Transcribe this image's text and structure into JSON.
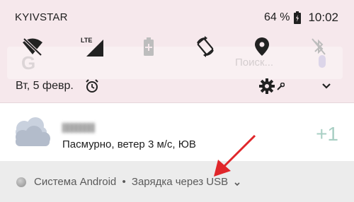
{
  "status_bar": {
    "carrier": "KYIVSTAR",
    "battery_percent": "64 %",
    "time": "10:02",
    "icons": [
      "battery-charging-icon"
    ]
  },
  "quick_settings": {
    "tiles": [
      {
        "name": "wifi-off-icon"
      },
      {
        "name": "mobile-signal-lte-icon",
        "badge": "LTE"
      },
      {
        "name": "battery-saver-icon"
      },
      {
        "name": "auto-rotate-icon"
      },
      {
        "name": "location-icon"
      },
      {
        "name": "bluetooth-off-icon"
      }
    ],
    "background_search": {
      "placeholder": "Поиск..."
    },
    "date": "Вт, 5 февр."
  },
  "weather_notification": {
    "description": "Пасмурно, ветер 3 м/с, ЮВ",
    "temperature": "+1"
  },
  "system_notification": {
    "app": "Система Android",
    "separator": "•",
    "message": "Зарядка через USB"
  },
  "colors": {
    "shade_bg": "#f6e8ec",
    "card_bg": "#ffffff",
    "system_row_bg": "#ececec",
    "temperature": "#a9cfc4",
    "annotation": "#e0262a"
  }
}
